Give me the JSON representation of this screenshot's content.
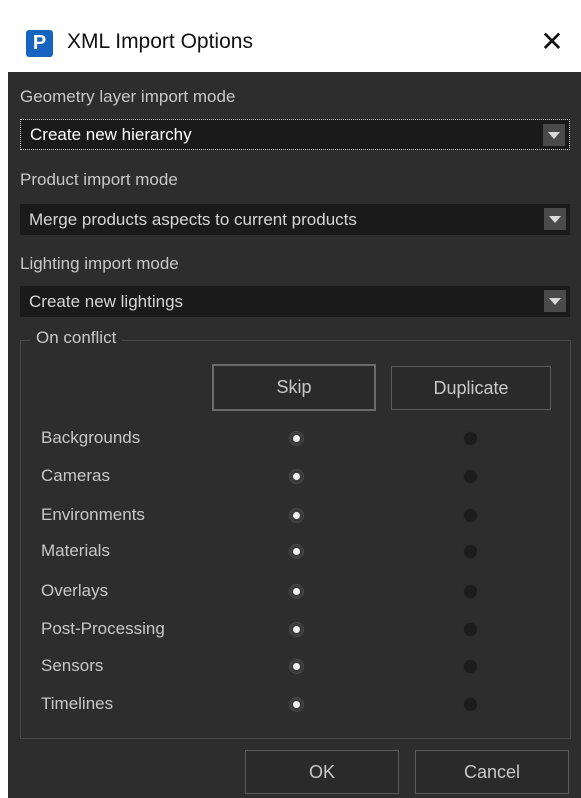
{
  "window": {
    "title": "XML Import Options",
    "app_icon_glyph": "P",
    "close_glyph": "✕"
  },
  "geometry": {
    "label": "Geometry layer import mode",
    "value": "Create new hierarchy"
  },
  "product": {
    "label": "Product import mode",
    "value": "Merge products aspects to current products"
  },
  "lighting": {
    "label": "Lighting import mode",
    "value": "Create new lightings"
  },
  "conflict": {
    "title": "On conflict",
    "skip_label": "Skip",
    "duplicate_label": "Duplicate",
    "rows": [
      {
        "label": "Backgrounds",
        "selected": "skip"
      },
      {
        "label": "Cameras",
        "selected": "skip"
      },
      {
        "label": "Environments",
        "selected": "skip"
      },
      {
        "label": "Materials",
        "selected": "skip"
      },
      {
        "label": "Overlays",
        "selected": "skip"
      },
      {
        "label": "Post-Processing",
        "selected": "skip"
      },
      {
        "label": "Sensors",
        "selected": "skip"
      },
      {
        "label": "Timelines",
        "selected": "skip"
      }
    ]
  },
  "footer": {
    "ok_label": "OK",
    "cancel_label": "Cancel"
  }
}
